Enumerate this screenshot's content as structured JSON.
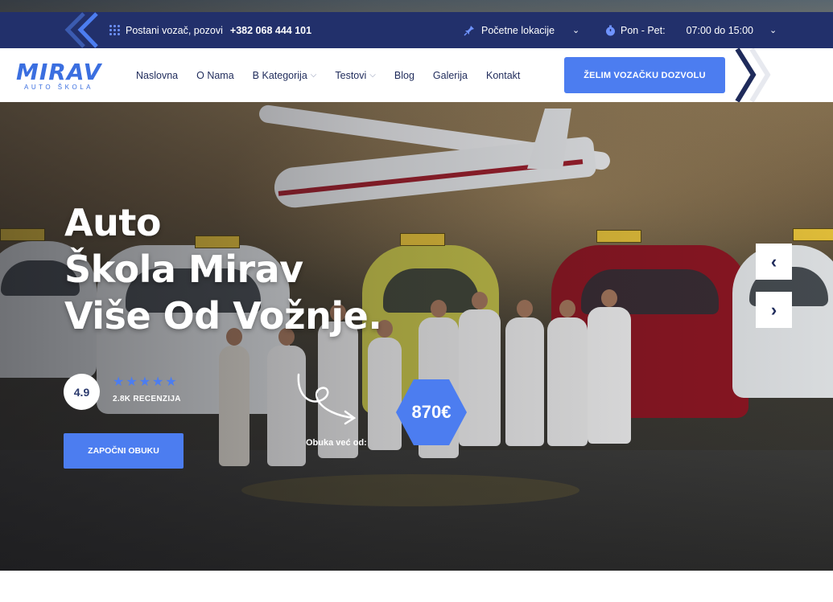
{
  "topbar": {
    "contact_text": "Postani vozač, pozovi",
    "phone": "+382 068 444 101",
    "location_label": "Početne lokacije",
    "hours_days": "Pon - Pet:",
    "hours_time": "07:00 do 15:00"
  },
  "nav": {
    "logo_word": "MIRAV",
    "logo_sub": "AUTO ŠKOLA",
    "items": [
      {
        "label": "Naslovna",
        "has_dropdown": false
      },
      {
        "label": "O Nama",
        "has_dropdown": false
      },
      {
        "label": "B Kategorija",
        "has_dropdown": true
      },
      {
        "label": "Testovi",
        "has_dropdown": true
      },
      {
        "label": "Blog",
        "has_dropdown": false
      },
      {
        "label": "Galerija",
        "has_dropdown": false
      },
      {
        "label": "Kontakt",
        "has_dropdown": false
      }
    ],
    "cta_label": "ŽELIM VOZAČKU DOZVOLU"
  },
  "hero": {
    "title_lines": [
      "Auto",
      "Škola Mirav",
      "Više Od Vožnje."
    ],
    "rating": "4.9",
    "stars": 5,
    "reviews": "2.8K RECENZIJA",
    "start_button": "ZAPOČNI OBUKU",
    "price_label": "Obuka već od:",
    "price": "870€",
    "prev_arrow": "‹",
    "next_arrow": "›"
  },
  "colors": {
    "brand_blue": "#4c7df0",
    "topbar_navy": "#22306b",
    "nav_text": "#1f2b5b"
  },
  "icons": {
    "contact": "dots-grid-icon",
    "location": "pin-icon",
    "hours": "stopwatch-icon",
    "dropdown": "chevron-down-icon",
    "slider_prev": "chevron-left-icon",
    "slider_next": "chevron-right-icon"
  }
}
